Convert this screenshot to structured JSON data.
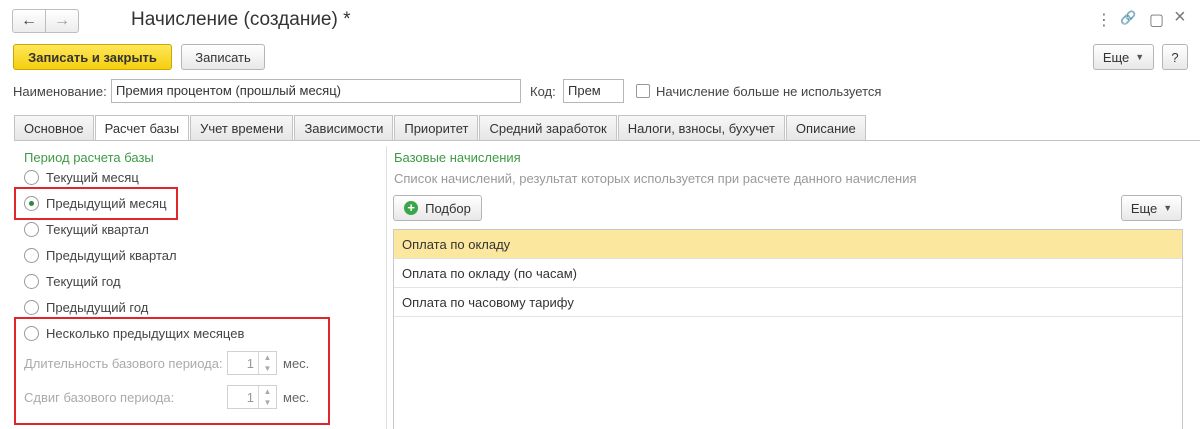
{
  "window": {
    "title": "Начисление (создание) *",
    "back_icon": "←",
    "forward_icon": "→",
    "menu_icon": "⋮",
    "link_icon": "🔗",
    "maximize_icon": "▢",
    "close_icon": "×"
  },
  "toolbar": {
    "save_close_label": "Записать и закрыть",
    "save_label": "Записать",
    "more_label": "Еще",
    "help_label": "?"
  },
  "form": {
    "name_label": "Наименование:",
    "name_value": "Премия процентом (прошлый месяц)",
    "code_label": "Код:",
    "code_value": "Прем",
    "unused_label": "Начисление больше не используется"
  },
  "tabs": [
    {
      "label": "Основное"
    },
    {
      "label": "Расчет базы"
    },
    {
      "label": "Учет времени"
    },
    {
      "label": "Зависимости"
    },
    {
      "label": "Приоритет"
    },
    {
      "label": "Средний заработок"
    },
    {
      "label": "Налоги, взносы, бухучет"
    },
    {
      "label": "Описание"
    }
  ],
  "period": {
    "title": "Период расчета базы",
    "options": [
      {
        "label": "Текущий месяц",
        "checked": false
      },
      {
        "label": "Предыдущий месяц",
        "checked": true
      },
      {
        "label": "Текущий квартал",
        "checked": false
      },
      {
        "label": "Предыдущий квартал",
        "checked": false
      },
      {
        "label": "Текущий год",
        "checked": false
      },
      {
        "label": "Предыдущий год",
        "checked": false
      },
      {
        "label": "Несколько предыдущих месяцев",
        "checked": false
      }
    ],
    "duration_label": "Длительность базового периода:",
    "duration_value": "1",
    "duration_unit": "мес.",
    "shift_label": "Сдвиг базового периода:",
    "shift_value": "1",
    "shift_unit": "мес."
  },
  "base": {
    "title": "Базовые начисления",
    "description": "Список начислений, результат которых используется при расчете данного начисления",
    "select_label": "Подбор",
    "more_label": "Еще",
    "rows": [
      "Оплата по окладу",
      "Оплата по окладу (по часам)",
      "Оплата по часовому тарифу"
    ]
  },
  "colors": {
    "accent_green": "#3c9b45",
    "highlight_red": "#e0252b",
    "selected_row": "#fbe79d",
    "primary_button": "#f5cf0e"
  }
}
